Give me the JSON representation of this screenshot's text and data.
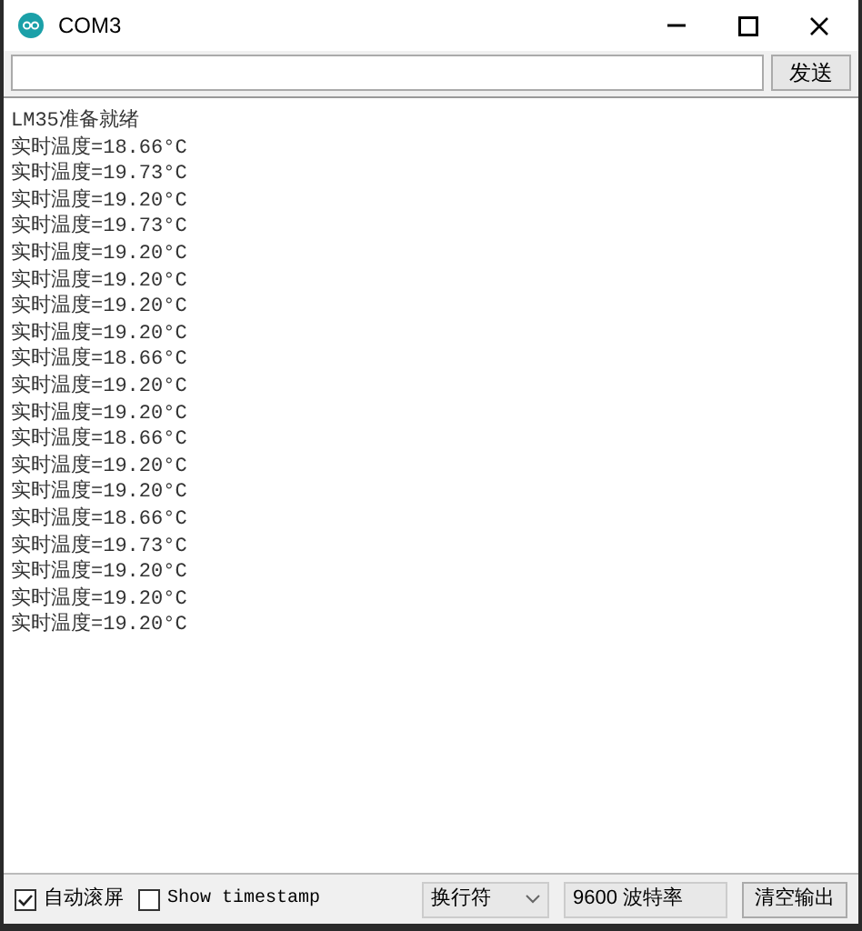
{
  "window": {
    "title": "COM3"
  },
  "send": {
    "button": "发送"
  },
  "output": {
    "lines": [
      "LM35准备就绪",
      "实时温度=18.66°C",
      "实时温度=19.73°C",
      "实时温度=19.20°C",
      "实时温度=19.73°C",
      "实时温度=19.20°C",
      "实时温度=19.20°C",
      "实时温度=19.20°C",
      "实时温度=19.20°C",
      "实时温度=18.66°C",
      "实时温度=19.20°C",
      "实时温度=19.20°C",
      "实时温度=18.66°C",
      "实时温度=19.20°C",
      "实时温度=19.20°C",
      "实时温度=18.66°C",
      "实时温度=19.73°C",
      "实时温度=19.20°C",
      "实时温度=19.20°C",
      "实时温度=19.20°C"
    ]
  },
  "footer": {
    "autoscroll": {
      "label": "自动滚屏",
      "checked": true
    },
    "timestamp": {
      "label": "Show timestamp",
      "checked": false
    },
    "line_ending": "换行符",
    "baud": "9600 波特率",
    "clear_button": "清空输出"
  }
}
